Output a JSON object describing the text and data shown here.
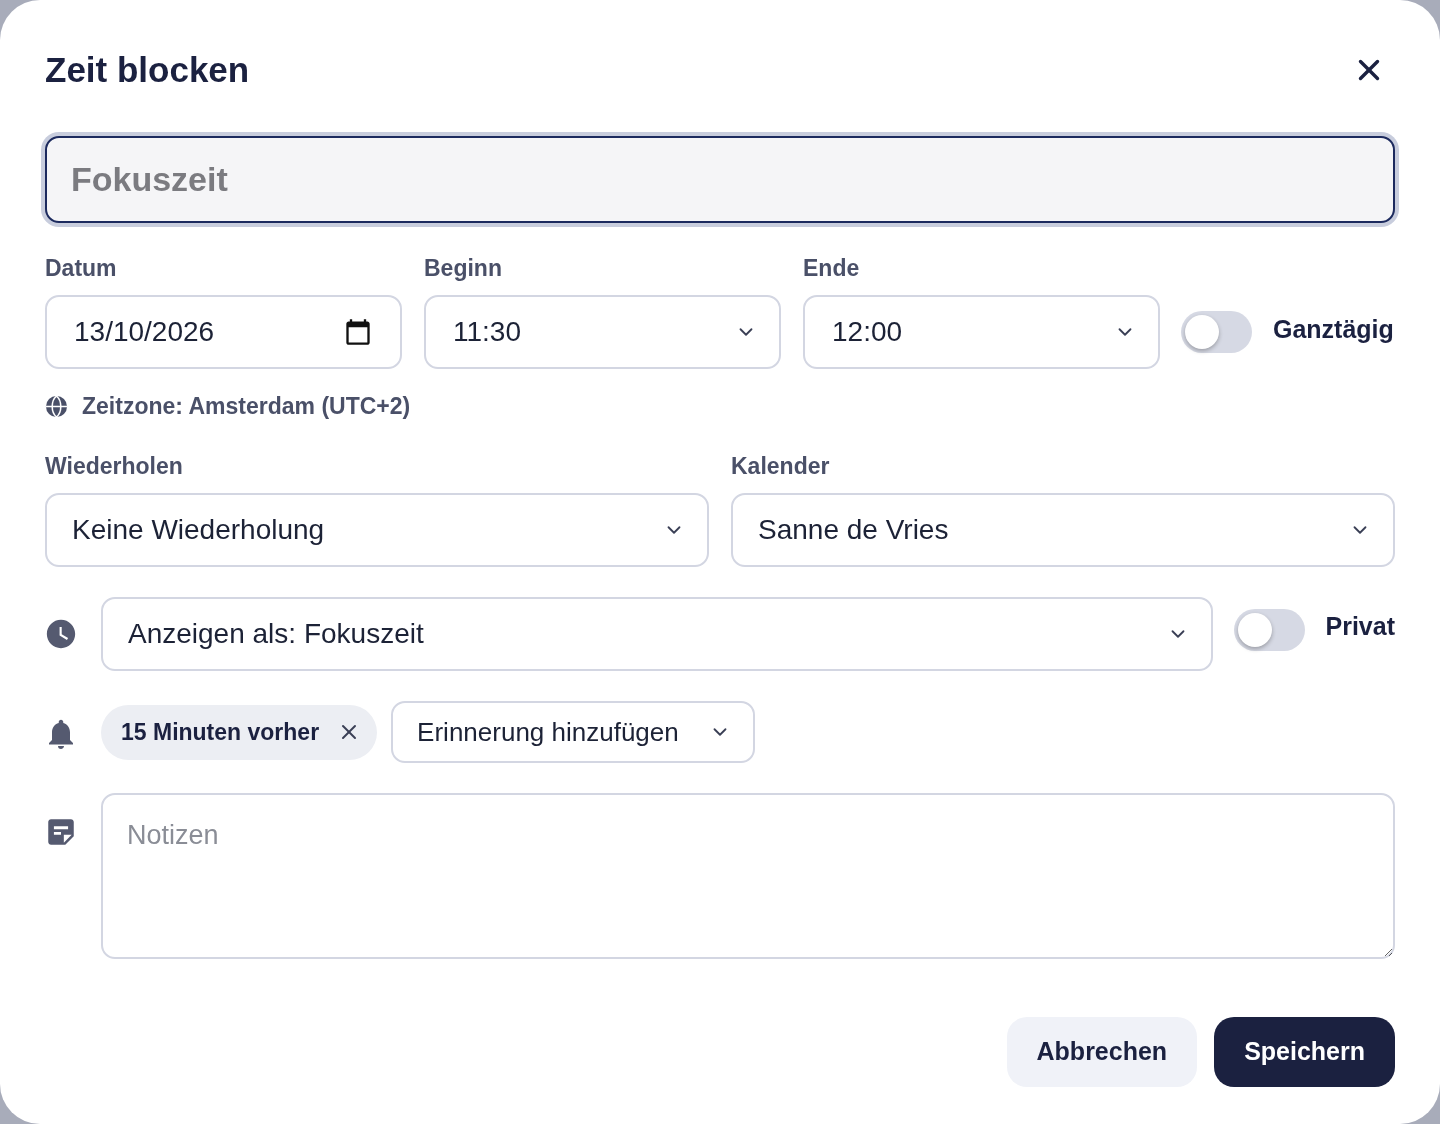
{
  "dialog": {
    "title": "Zeit blocken"
  },
  "title_field": {
    "placeholder": "Fokuszeit"
  },
  "time_fields": [
    {
      "label": "Datum",
      "value": "13/10/2026",
      "kind": "date"
    },
    {
      "label": "Beginn",
      "value": "11:30",
      "kind": "select"
    },
    {
      "label": "Ende",
      "value": "12:00",
      "kind": "select"
    }
  ],
  "all_day": {
    "label": "Ganztägig",
    "on": false
  },
  "timezone": "Zeitzone: Amsterdam (UTC+2)",
  "repeat": {
    "label": "Wiederholen",
    "value": "Keine Wiederholung"
  },
  "calendar": {
    "label": "Kalender",
    "value": "Sanne de Vries"
  },
  "show_as": {
    "value": "Anzeigen als: Fokuszeit"
  },
  "private": {
    "label": "Privat",
    "on": false
  },
  "reminders": {
    "chips": [
      "15 Minuten vorher"
    ],
    "add_label": "Erinnerung hinzufügen"
  },
  "notes": {
    "placeholder": "Notizen"
  },
  "buttons": [
    {
      "label": "Abbrechen",
      "kind": "secondary"
    },
    {
      "label": "Speichern",
      "kind": "primary"
    }
  ]
}
